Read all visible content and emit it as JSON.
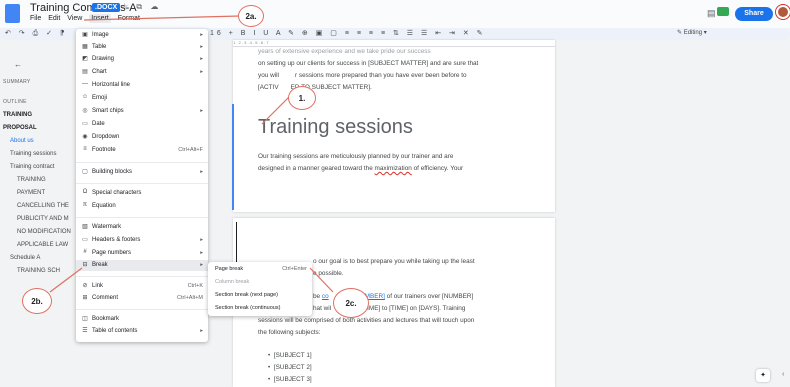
{
  "header": {
    "title": "Training Comments-A",
    "badge": ".DOCX",
    "icons": "☆ ⧉ ☁",
    "menu": [
      "File",
      "Edit",
      "View",
      "Insert",
      "Format"
    ],
    "share_label": "Share",
    "editing_label": "Editing"
  },
  "toolbar": {
    "left_icons": "↶ ↷ ⎙ ✓ ⁋",
    "font_size_icons": "16 +",
    "mid_icons": "B I U A ✎ ⊕ ▣ ▢ ≡ ≡ ≡ ≡ ⇅ ☰ ☰ ⇤ ⇥ ✕ ✎"
  },
  "sidebar": {
    "summary": "SUMMARY",
    "outline": "OUTLINE",
    "items": [
      "TRAINING",
      "PROPOSAL",
      "About us",
      "Training sessions",
      "Training contract",
      "TRAINING",
      "PAYMENT",
      "CANCELLING THE",
      "PUBLICITY AND M",
      "NO MODIFICATION",
      "APPLICABLE LAW",
      "Schedule A",
      "TRAINING SCH"
    ]
  },
  "document": {
    "ruler": "1   .   2   .   3   .   4   .   5   .   6   .   7",
    "p1_line1": "years of extensive experience and we take pride our success",
    "p1_line2": "on setting up our clients for success in [SUBJECT MATTER] and are sure that",
    "p1_line3_a": "you will",
    "p1_line3_b": "r sessions more prepared than you have ever been before to",
    "p1_line4_a": "[ACTIV",
    "p1_line4_b": "ED TO SUBJECT MATTER].",
    "heading": "Training sessions",
    "p2_line1": "Our training sessions are meticulously planned by our trainer and are",
    "p2_line2_a": "designed in a manner geared toward the ",
    "p2_line2_link": "maximization",
    "p2_line2_b": " of efficiency. Your",
    "p3_line1": "o our goal is to best prepare you while taking up the least",
    "p3_line2": "e possible.",
    "p4_line1_a": "be ",
    "p4_line1_link": "co",
    "p4_line1_link2": "y [NUMBER]",
    "p4_line1_b": " of our trainers over [NUMBER]",
    "p4_line2_a": "hat wil",
    "p4_line2_b": "n [TIME] to [TIME] on [DAYS]. Training",
    "p4_line3": "sessions will be comprised of both activities and lectures that will touch upon",
    "p4_line4": "the following subjects:",
    "bullets": [
      "[SUBJECT 1]",
      "[SUBJECT 2]",
      "[SUBJECT 3]"
    ]
  },
  "insert_menu": {
    "items": [
      {
        "icon": "▣",
        "label": "Image",
        "shortcut": "▸"
      },
      {
        "icon": "▦",
        "label": "Table",
        "shortcut": "▸"
      },
      {
        "icon": "◩",
        "label": "Drawing",
        "shortcut": "▸"
      },
      {
        "icon": "▤",
        "label": "Chart",
        "shortcut": "▸"
      },
      {
        "icon": "—",
        "label": "Horizontal line",
        "shortcut": ""
      },
      {
        "icon": "☺",
        "label": "Emoji",
        "shortcut": ""
      },
      {
        "icon": "◎",
        "label": "Smart chips",
        "shortcut": "▸"
      },
      {
        "icon": "▭",
        "label": "Date",
        "shortcut": ""
      },
      {
        "icon": "◉",
        "label": "Dropdown",
        "shortcut": ""
      },
      {
        "icon": "≡",
        "label": "Footnote",
        "shortcut": "Ctrl+Alt+F"
      },
      {
        "icon": "▢",
        "label": "Building blocks",
        "shortcut": "▸"
      },
      {
        "icon": "Ω",
        "label": "Special characters",
        "shortcut": ""
      },
      {
        "icon": "π",
        "label": "Equation",
        "shortcut": ""
      },
      {
        "icon": "▧",
        "label": "Watermark",
        "shortcut": ""
      },
      {
        "icon": "▭",
        "label": "Headers & footers",
        "shortcut": "▸"
      },
      {
        "icon": "#",
        "label": "Page numbers",
        "shortcut": "▸"
      },
      {
        "icon": "⊟",
        "label": "Break",
        "shortcut": "▸"
      },
      {
        "icon": "⊘",
        "label": "Link",
        "shortcut": "Ctrl+K"
      },
      {
        "icon": "⊞",
        "label": "Comment",
        "shortcut": "Ctrl+Alt+M"
      },
      {
        "icon": "◫",
        "label": "Bookmark",
        "shortcut": ""
      },
      {
        "icon": "☰",
        "label": "Table of contents",
        "shortcut": "▸"
      }
    ]
  },
  "break_submenu": {
    "items": [
      {
        "label": "Page break",
        "shortcut": "Ctrl+Enter"
      },
      {
        "label": "Column break",
        "shortcut": ""
      },
      {
        "label": "Section break (next page)",
        "shortcut": ""
      },
      {
        "label": "Section break (continuous)",
        "shortcut": ""
      }
    ]
  },
  "annotations": {
    "c1": "1.",
    "c2a": "2a.",
    "c2b": "2b.",
    "c2c": "2c."
  },
  "colors": {
    "accent": "#1a73e8",
    "annotation": "#e07060"
  }
}
